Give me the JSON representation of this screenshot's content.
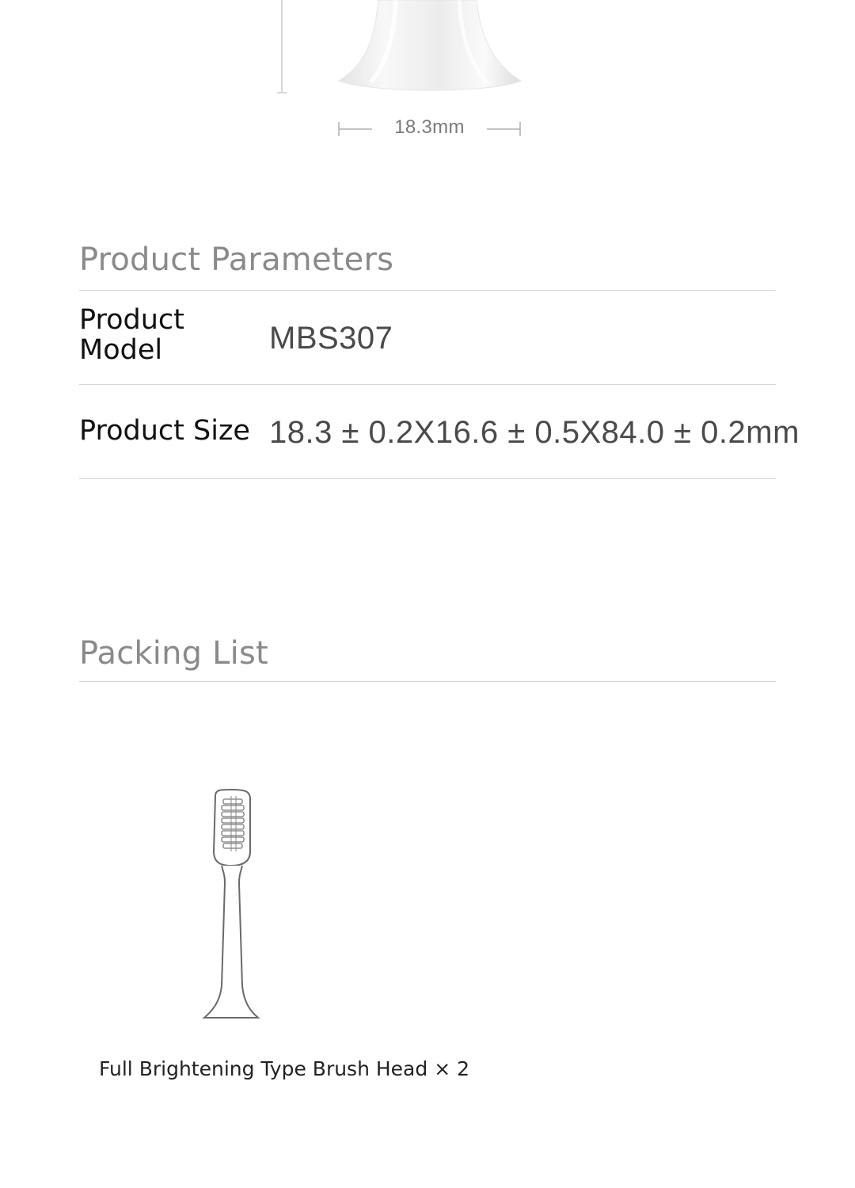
{
  "dimension": {
    "width_label": "18.3mm"
  },
  "parameters": {
    "title": "Product Parameters",
    "rows": [
      {
        "label": "Product Model",
        "value": "MBS307"
      },
      {
        "label": "Product Size",
        "value": "18.3 ± 0.2X16.6 ± 0.5X84.0 ± 0.2mm"
      }
    ]
  },
  "packing": {
    "title": "Packing List",
    "items": [
      {
        "label": "Full Brightening Type Brush Head × 2"
      }
    ]
  },
  "colors": {
    "heading": "#8a8a8a",
    "text": "#111111",
    "value": "#4a4a4a",
    "rule": "#d6d6d6"
  }
}
